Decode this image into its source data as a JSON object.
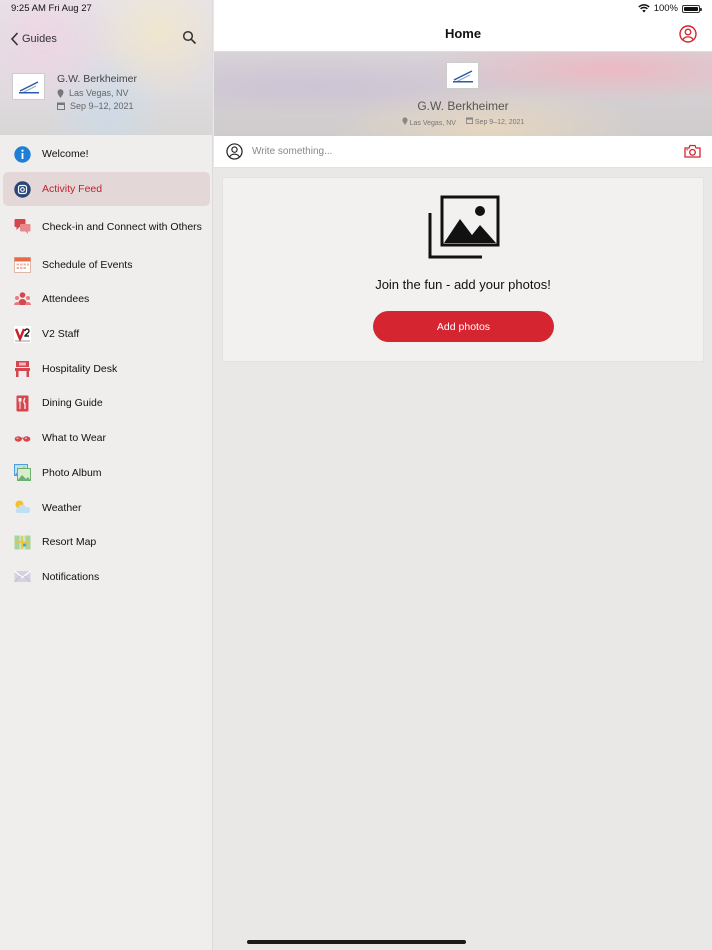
{
  "status_bar": {
    "time_date": "9:25 AM   Fri Aug 27",
    "battery_label": "100%",
    "battery_level": 1.0
  },
  "sidebar": {
    "back_label": "Guides",
    "event": {
      "name": "G.W. Berkheimer",
      "location": "Las Vegas, NV",
      "dates": "Sep 9–12, 2021"
    },
    "items": [
      {
        "label": "Welcome!",
        "icon": "info-icon",
        "color": "#1f7fd6"
      },
      {
        "label": "Activity Feed",
        "icon": "instagram-icon",
        "color": "#27467a",
        "active": true
      },
      {
        "label": "Check-in and Connect with Others",
        "icon": "chat-bubbles-icon",
        "color": "#d6464e"
      },
      {
        "label": "Schedule of Events",
        "icon": "calendar-icon",
        "color": "#e46a48"
      },
      {
        "label": "Attendees",
        "icon": "people-icon",
        "color": "#d6464e"
      },
      {
        "label": "V2 Staff",
        "icon": "v2-logo-icon",
        "color": "#c8202b"
      },
      {
        "label": "Hospitality Desk",
        "icon": "desk-icon",
        "color": "#d6464e"
      },
      {
        "label": "Dining Guide",
        "icon": "fork-knife-icon",
        "color": "#d6464e"
      },
      {
        "label": "What to Wear",
        "icon": "sunglasses-icon",
        "color": "#d6464e"
      },
      {
        "label": "Photo Album",
        "icon": "photo-album-icon",
        "color": "#4aa0d8"
      },
      {
        "label": "Weather",
        "icon": "weather-icon",
        "color": "#f2c02e"
      },
      {
        "label": "Resort Map",
        "icon": "map-icon",
        "color": "#6bb06b"
      },
      {
        "label": "Notifications",
        "icon": "envelope-icon",
        "color": "#b9b4c6"
      }
    ]
  },
  "main": {
    "nav_title": "Home",
    "hero": {
      "name": "G.W. Berkheimer",
      "location": "Las Vegas, NV",
      "dates": "Sep 9–12, 2021"
    },
    "composer": {
      "placeholder": "Write something..."
    },
    "empty_state": {
      "title": "Join the fun - add your photos!",
      "button_label": "Add photos"
    }
  },
  "colors": {
    "accent": "#d42530",
    "active_bg": "#e3d7d8",
    "sidebar_bg": "#efeeed",
    "content_bg": "#e9e8e7"
  }
}
